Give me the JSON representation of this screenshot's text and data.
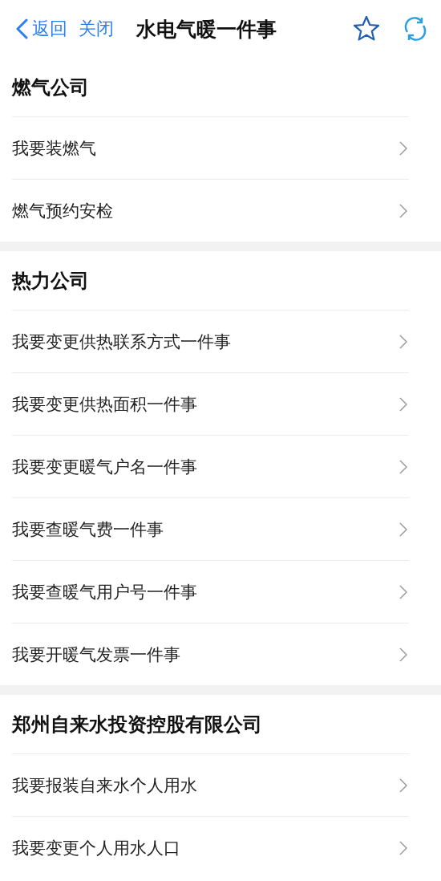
{
  "header": {
    "back": "返回",
    "close": "关闭",
    "title": "水电气暖一件事"
  },
  "sections": [
    {
      "title": "燃气公司",
      "items": [
        {
          "label": "我要装燃气"
        },
        {
          "label": "燃气预约安检"
        }
      ]
    },
    {
      "title": "热力公司",
      "items": [
        {
          "label": "我要变更供热联系方式一件事"
        },
        {
          "label": "我要变更供热面积一件事"
        },
        {
          "label": "我要变更暖气户名一件事"
        },
        {
          "label": "我要查暖气费一件事"
        },
        {
          "label": "我要查暖气用户号一件事"
        },
        {
          "label": "我要开暖气发票一件事"
        }
      ]
    },
    {
      "title": "郑州自来水投资控股有限公司",
      "items": [
        {
          "label": "我要报装自来水个人用水"
        },
        {
          "label": "我要变更个人用水人口"
        }
      ]
    }
  ]
}
